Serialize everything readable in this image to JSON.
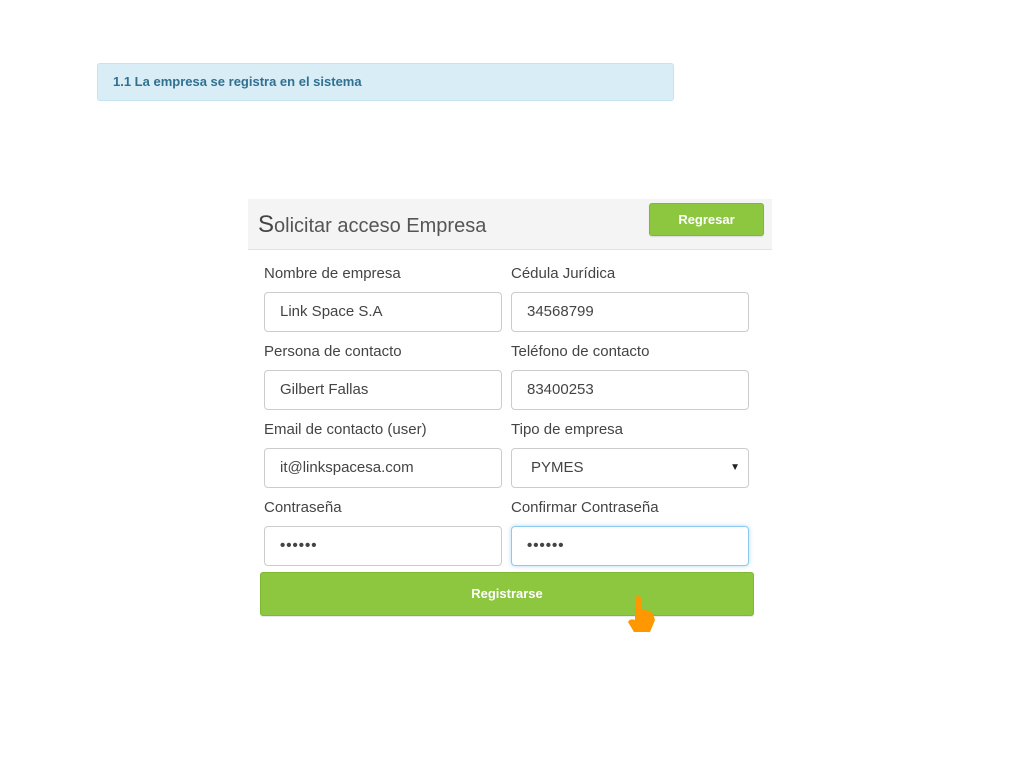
{
  "banner": {
    "text": "1.1 La empresa se registra en el sistema"
  },
  "panel": {
    "title_first": "S",
    "title_rest": "olicitar acceso Empresa",
    "back_label": "Regresar",
    "submit_label": "Registrarse"
  },
  "fields": [
    {
      "label": "Nombre de empresa",
      "value": "Link Space S.A"
    },
    {
      "label": "Cédula Jurídica",
      "value": "34568799"
    },
    {
      "label": "Persona de contacto",
      "value": "Gilbert Fallas"
    },
    {
      "label": "Teléfono de contacto",
      "value": "83400253"
    },
    {
      "label": "Email de contacto (user)",
      "value": "it@linkspacesa.com"
    },
    {
      "label": "Tipo de empresa",
      "value": "PYMES"
    },
    {
      "label": "Contraseña",
      "value": "••••••"
    },
    {
      "label": "Confirmar Contraseña",
      "value": "••••••"
    }
  ],
  "colors": {
    "accent": "#8dc63f",
    "banner_bg": "#d9edf7",
    "banner_text": "#31708f",
    "cursor": "#ff9800"
  },
  "icons": {
    "select": "caret-down-icon",
    "cursor": "hand-pointer-icon"
  }
}
